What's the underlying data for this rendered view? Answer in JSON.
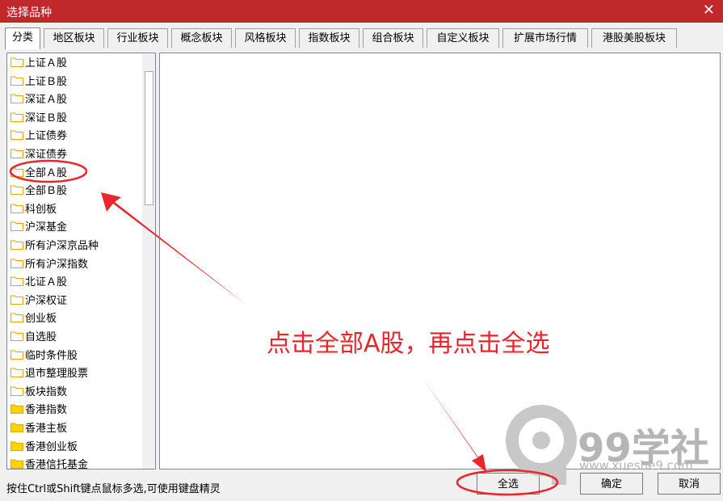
{
  "window": {
    "title": "选择品种",
    "close_glyph": "✕"
  },
  "tabs": [
    {
      "label": "分类",
      "active": true
    },
    {
      "label": "地区板块"
    },
    {
      "label": "行业板块"
    },
    {
      "label": "概念板块"
    },
    {
      "label": "风格板块"
    },
    {
      "label": "指数板块"
    },
    {
      "label": "组合板块"
    },
    {
      "label": "自定义板块"
    },
    {
      "label": "扩展市场行情"
    },
    {
      "label": "港股美股板块"
    }
  ],
  "tree": [
    {
      "label": "上证Ａ股",
      "icon": "folder-icon"
    },
    {
      "label": "上证Ｂ股",
      "icon": "folder-icon"
    },
    {
      "label": "深证Ａ股",
      "icon": "folder-icon"
    },
    {
      "label": "深证Ｂ股",
      "icon": "folder-icon"
    },
    {
      "label": "上证债券",
      "icon": "folder-icon"
    },
    {
      "label": "深证债券",
      "icon": "folder-icon"
    },
    {
      "label": "全部Ａ股",
      "icon": "folder-icon",
      "highlighted": true
    },
    {
      "label": "全部Ｂ股",
      "icon": "folder-icon"
    },
    {
      "label": "科创板",
      "icon": "folder-icon"
    },
    {
      "label": "沪深基金",
      "icon": "folder-icon"
    },
    {
      "label": "所有沪深京品种",
      "icon": "folder-icon"
    },
    {
      "label": "所有沪深指数",
      "icon": "folder-icon"
    },
    {
      "label": "北证Ａ股",
      "icon": "folder-icon"
    },
    {
      "label": "沪深权证",
      "icon": "folder-icon"
    },
    {
      "label": "创业板",
      "icon": "folder-icon"
    },
    {
      "label": "自选股",
      "icon": "folder-icon"
    },
    {
      "label": "临时条件股",
      "icon": "folder-icon"
    },
    {
      "label": "退市整理股票",
      "icon": "folder-icon"
    },
    {
      "label": "板块指数",
      "icon": "folder-icon"
    },
    {
      "label": "香港指数",
      "icon": "folder-icon-yellow"
    },
    {
      "label": "香港主板",
      "icon": "folder-icon-yellow"
    },
    {
      "label": "香港创业板",
      "icon": "folder-icon-yellow"
    },
    {
      "label": "香港信托基金",
      "icon": "folder-icon-yellow"
    }
  ],
  "status_text": "按住Ctrl或Shift键点鼠标多选,可使用键盘精灵",
  "buttons": {
    "select_all": "全选",
    "ok": "确定",
    "cancel": "取消"
  },
  "annotation": {
    "text": "点击全部A股，再点击全选",
    "color": "#e8262b"
  },
  "watermark": {
    "brand": "99学社",
    "url": "www.xueshe9.com"
  },
  "colors": {
    "titlebar": "#c0282b",
    "folder_outline": "#e0a800",
    "folder_fill_light": "#ffffff",
    "folder_fill_yellow": "#ffd200",
    "annotation": "#e8262b"
  }
}
